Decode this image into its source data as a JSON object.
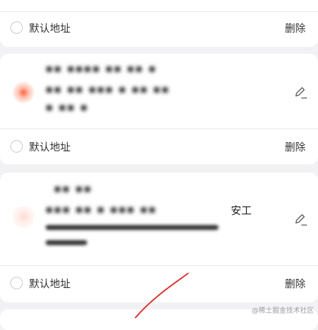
{
  "addresses": [
    {
      "default_label": "默认地址",
      "delete_label": "删除"
    },
    {
      "default_label": "默认地址",
      "delete_label": "删除",
      "name_line": "▪▪ ▪▪▪▪ ▪▪ ▪▪ ▪",
      "address_line": "▪▪ ▪▪ ▪▪▪ ▪ ▪▪ ▪▪",
      "extra_line": "▪ ▪▪ ▪"
    },
    {
      "default_label": "默认地址",
      "delete_label": "删除",
      "name_line": "▪▪ ▪▪",
      "address_line": "▪▪▪ ▪▪ ▪ ▪▪▪ ▪▪",
      "visible_text": "安工"
    }
  ],
  "watermark": "@稀土掘金技术社区",
  "colors": {
    "accent": "#ff5630",
    "delete_text": "#333333",
    "background": "#f2f2f4"
  },
  "icons": {
    "edit": "pencil-edit-icon",
    "location": "location-marker-icon"
  }
}
